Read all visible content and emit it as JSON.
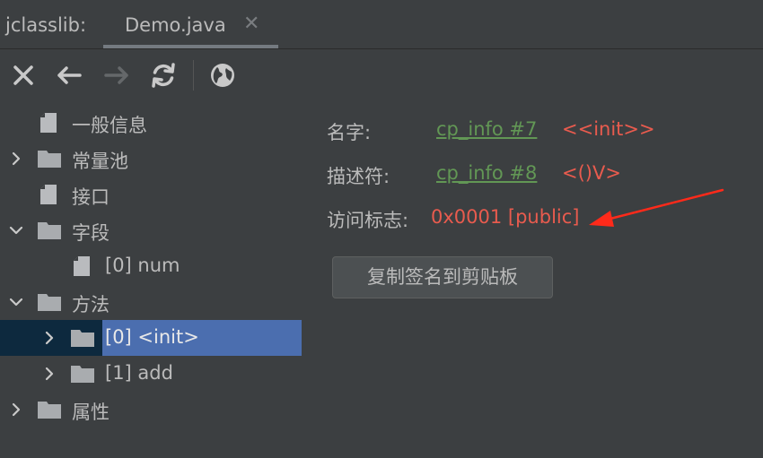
{
  "tabbar": {
    "title": "jclasslib:",
    "tab_label": "Demo.java",
    "tab_close": "✕"
  },
  "toolbar": {
    "buttons": [
      "close-icon",
      "back-arrow-icon",
      "forward-arrow-icon",
      "refresh-icon",
      "web-icon"
    ]
  },
  "tree": {
    "general_info": "一般信息",
    "constant_pool": "常量池",
    "interfaces": "接口",
    "fields": "字段",
    "field_0": "[0] num",
    "methods": "方法",
    "method_0": "[0] <init>",
    "method_1": "[1] add",
    "attributes": "属性"
  },
  "detail": {
    "name_label": "名字:",
    "name_link": "cp_info #7",
    "name_value": "<<init>>",
    "descriptor_label": "描述符:",
    "descriptor_link": "cp_info #8",
    "descriptor_value": "<()V>",
    "access_label": "访问标志:",
    "access_value": "0x0001 [public]",
    "copy_button": "复制签名到剪贴板"
  },
  "colors": {
    "background": "#3c3f41",
    "link_green": "#629755",
    "value_red": "#e85b4e",
    "selection_blue": "#4b6eaf",
    "selection_row": "#0d293e",
    "annotation_arrow": "#ff2a1a"
  }
}
